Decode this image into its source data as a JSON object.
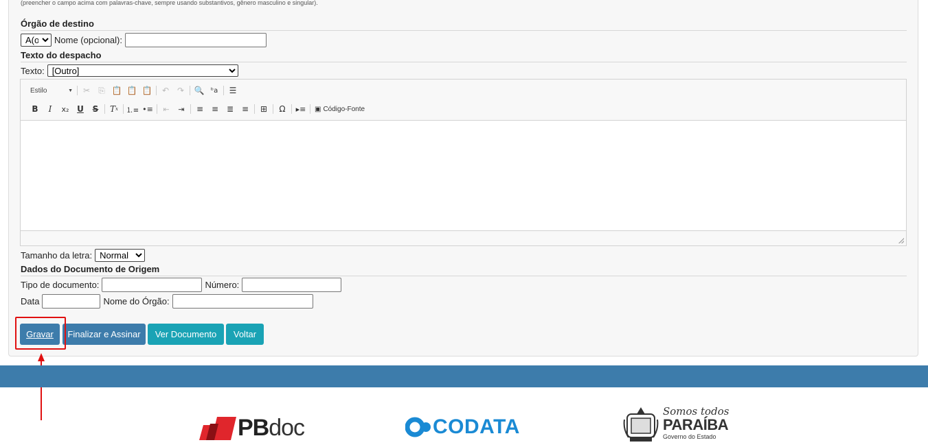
{
  "hint_text": "(preencher o campo acima com palavras-chave, sempre usando substantivos, gênero masculino e singular).",
  "orgao_destino": {
    "title": "Órgão de destino",
    "select_value": "A(o)",
    "nome_label": "Nome (opcional):",
    "nome_value": ""
  },
  "texto_despacho": {
    "title": "Texto do despacho",
    "texto_label": "Texto:",
    "texto_value": "[Outro]"
  },
  "editor": {
    "style_combo": "Estilo",
    "source_label": "Código-Fonte",
    "toolbar_row1_icons": [
      "cut-icon",
      "copy-icon",
      "paste-icon",
      "paste-text-icon",
      "paste-word-icon",
      "undo-icon",
      "redo-icon",
      "find-icon",
      "replace-icon",
      "blocks-icon"
    ],
    "toolbar_row2_icons": [
      "bold-icon",
      "italic-icon",
      "subscript-icon",
      "underline-icon",
      "strike-icon",
      "remove-format-icon",
      "numbered-list-icon",
      "bulleted-list-icon",
      "outdent-icon",
      "indent-icon",
      "align-left-icon",
      "align-center-icon",
      "align-justify-icon",
      "align-right-icon",
      "table-icon",
      "special-char-icon",
      "page-break-icon",
      "source-icon"
    ],
    "content": ""
  },
  "tamanho_letra": {
    "label": "Tamanho da letra:",
    "value": "Normal"
  },
  "dados_documento": {
    "title": "Dados do Documento de Origem",
    "tipo_label": "Tipo de documento:",
    "numero_label": "Número:",
    "data_label": "Data",
    "nome_orgao_label": "Nome do Órgão:"
  },
  "buttons": {
    "gravar": "Gravar",
    "finalizar": "Finalizar e Assinar",
    "ver_documento": "Ver Documento",
    "voltar": "Voltar"
  },
  "footer": {
    "pbdoc_pb": "PB",
    "pbdoc_doc": "doc",
    "codata": "CODATA",
    "paraiba_tagline": "Somos todos",
    "paraiba_name": "PARAÍBA",
    "paraiba_sub": "Governo do Estado"
  },
  "colors": {
    "primary_button": "#3d7cab",
    "secondary_button": "#1aa3b5",
    "footer_band": "#3d7cab",
    "annotation": "#e01010",
    "pbdoc_red": "#e0262c",
    "codata_blue": "#1a8ad4"
  }
}
